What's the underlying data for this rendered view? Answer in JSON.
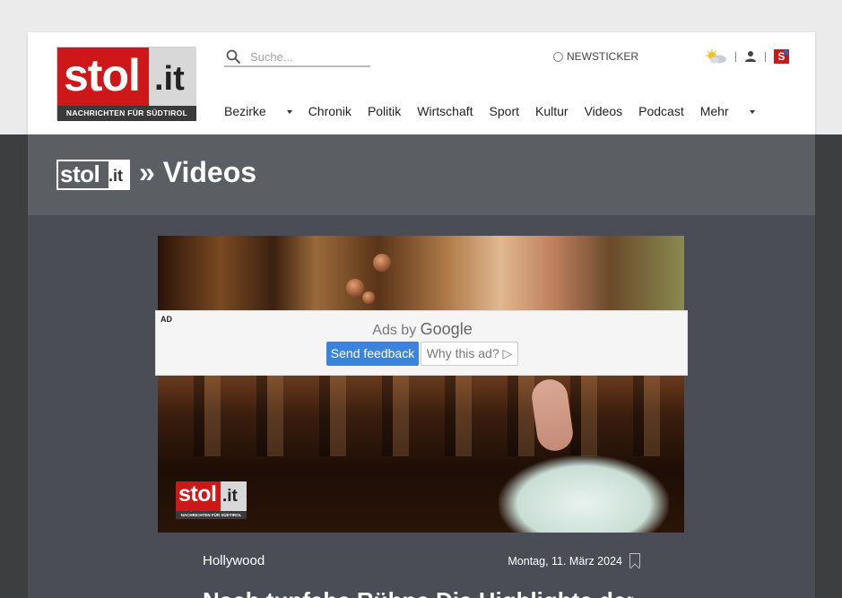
{
  "header": {
    "logo": {
      "brand": "stol",
      "suffix": ".it",
      "tagline": "NACHRICHTEN FÜR SÜDTIROL"
    },
    "search": {
      "placeholder": "Suche..."
    },
    "newsticker": "NEWSTICKER",
    "nav": [
      {
        "label": "Bezirke",
        "dropdown": true
      },
      {
        "label": "Chronik"
      },
      {
        "label": "Politik"
      },
      {
        "label": "Wirtschaft"
      },
      {
        "label": "Sport"
      },
      {
        "label": "Kultur"
      },
      {
        "label": "Videos"
      },
      {
        "label": "Podcast"
      },
      {
        "label": "Mehr",
        "dropdown": true
      }
    ],
    "icons": [
      "weather-icon",
      "user-icon",
      "s-plus-icon"
    ],
    "s_badge": "S"
  },
  "banner": {
    "brand": "stol",
    "suffix": ".it",
    "title": "» Videos"
  },
  "ad": {
    "tag": "AD",
    "ads_by": "Ads by",
    "google": "Google",
    "send_feedback": "Send feedback",
    "why_this_ad": "Why this ad? ▷"
  },
  "video": {
    "watermark_brand": "stol",
    "watermark_suffix": ".it",
    "watermark_tagline": "NACHRICHTEN FÜR SÜDTIROL"
  },
  "article": {
    "category": "Hollywood",
    "date": "Montag, 11. März 2024",
    "headline": "Nach tunfehe Rühne Die Highlighte der Os"
  },
  "colors": {
    "brand_red": "#cd1719",
    "banner_bg": "#5b5f63",
    "content_bg": "#4a4d55",
    "ad_blue": "#3a84df"
  }
}
